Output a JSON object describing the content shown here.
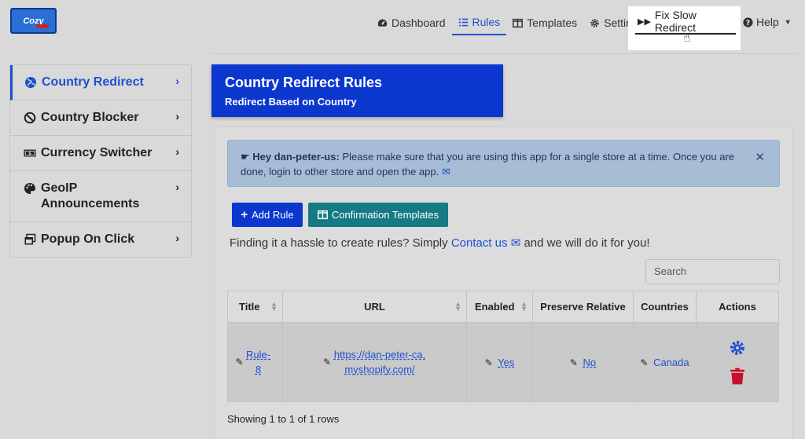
{
  "logo": {
    "text": "Cozy"
  },
  "nav": {
    "dashboard": "Dashboard",
    "rules": "Rules",
    "templates": "Templates",
    "settings": "Settings",
    "fix": "Fix Slow Redirect",
    "help": "Help"
  },
  "sidebar": {
    "items": [
      {
        "label": "Country Redirect"
      },
      {
        "label": "Country Blocker"
      },
      {
        "label": "Currency Switcher"
      },
      {
        "label": "GeoIP Announcements"
      },
      {
        "label": "Popup On Click"
      }
    ]
  },
  "header": {
    "title": "Country Redirect Rules",
    "subtitle": "Redirect Based on Country"
  },
  "alert": {
    "strong": "Hey dan-peter-us:",
    "text": "Please make sure that you are using this app for a single store at a time. Once you are done, login to other store and open the app."
  },
  "buttons": {
    "add_rule": "Add Rule",
    "confirmation_templates": "Confirmation Templates"
  },
  "hint": {
    "before": "Finding it a hassle to create rules? Simply",
    "link": "Contact us",
    "after": "and we will do it for you!"
  },
  "search": {
    "placeholder": "Search"
  },
  "table": {
    "columns": [
      "Title",
      "URL",
      "Enabled",
      "Preserve Relative",
      "Countries",
      "Actions"
    ],
    "rows": [
      {
        "title": "Rule-8",
        "url": "https://dan-peter-ca.myshopify.com/",
        "enabled": "Yes",
        "preserve": "No",
        "countries": "Canada"
      }
    ]
  },
  "footer": {
    "info": "Showing 1 to 1 of 1 rows"
  },
  "colors": {
    "primary": "#0b37cf",
    "teal": "#157a84",
    "danger": "#c8102e"
  }
}
